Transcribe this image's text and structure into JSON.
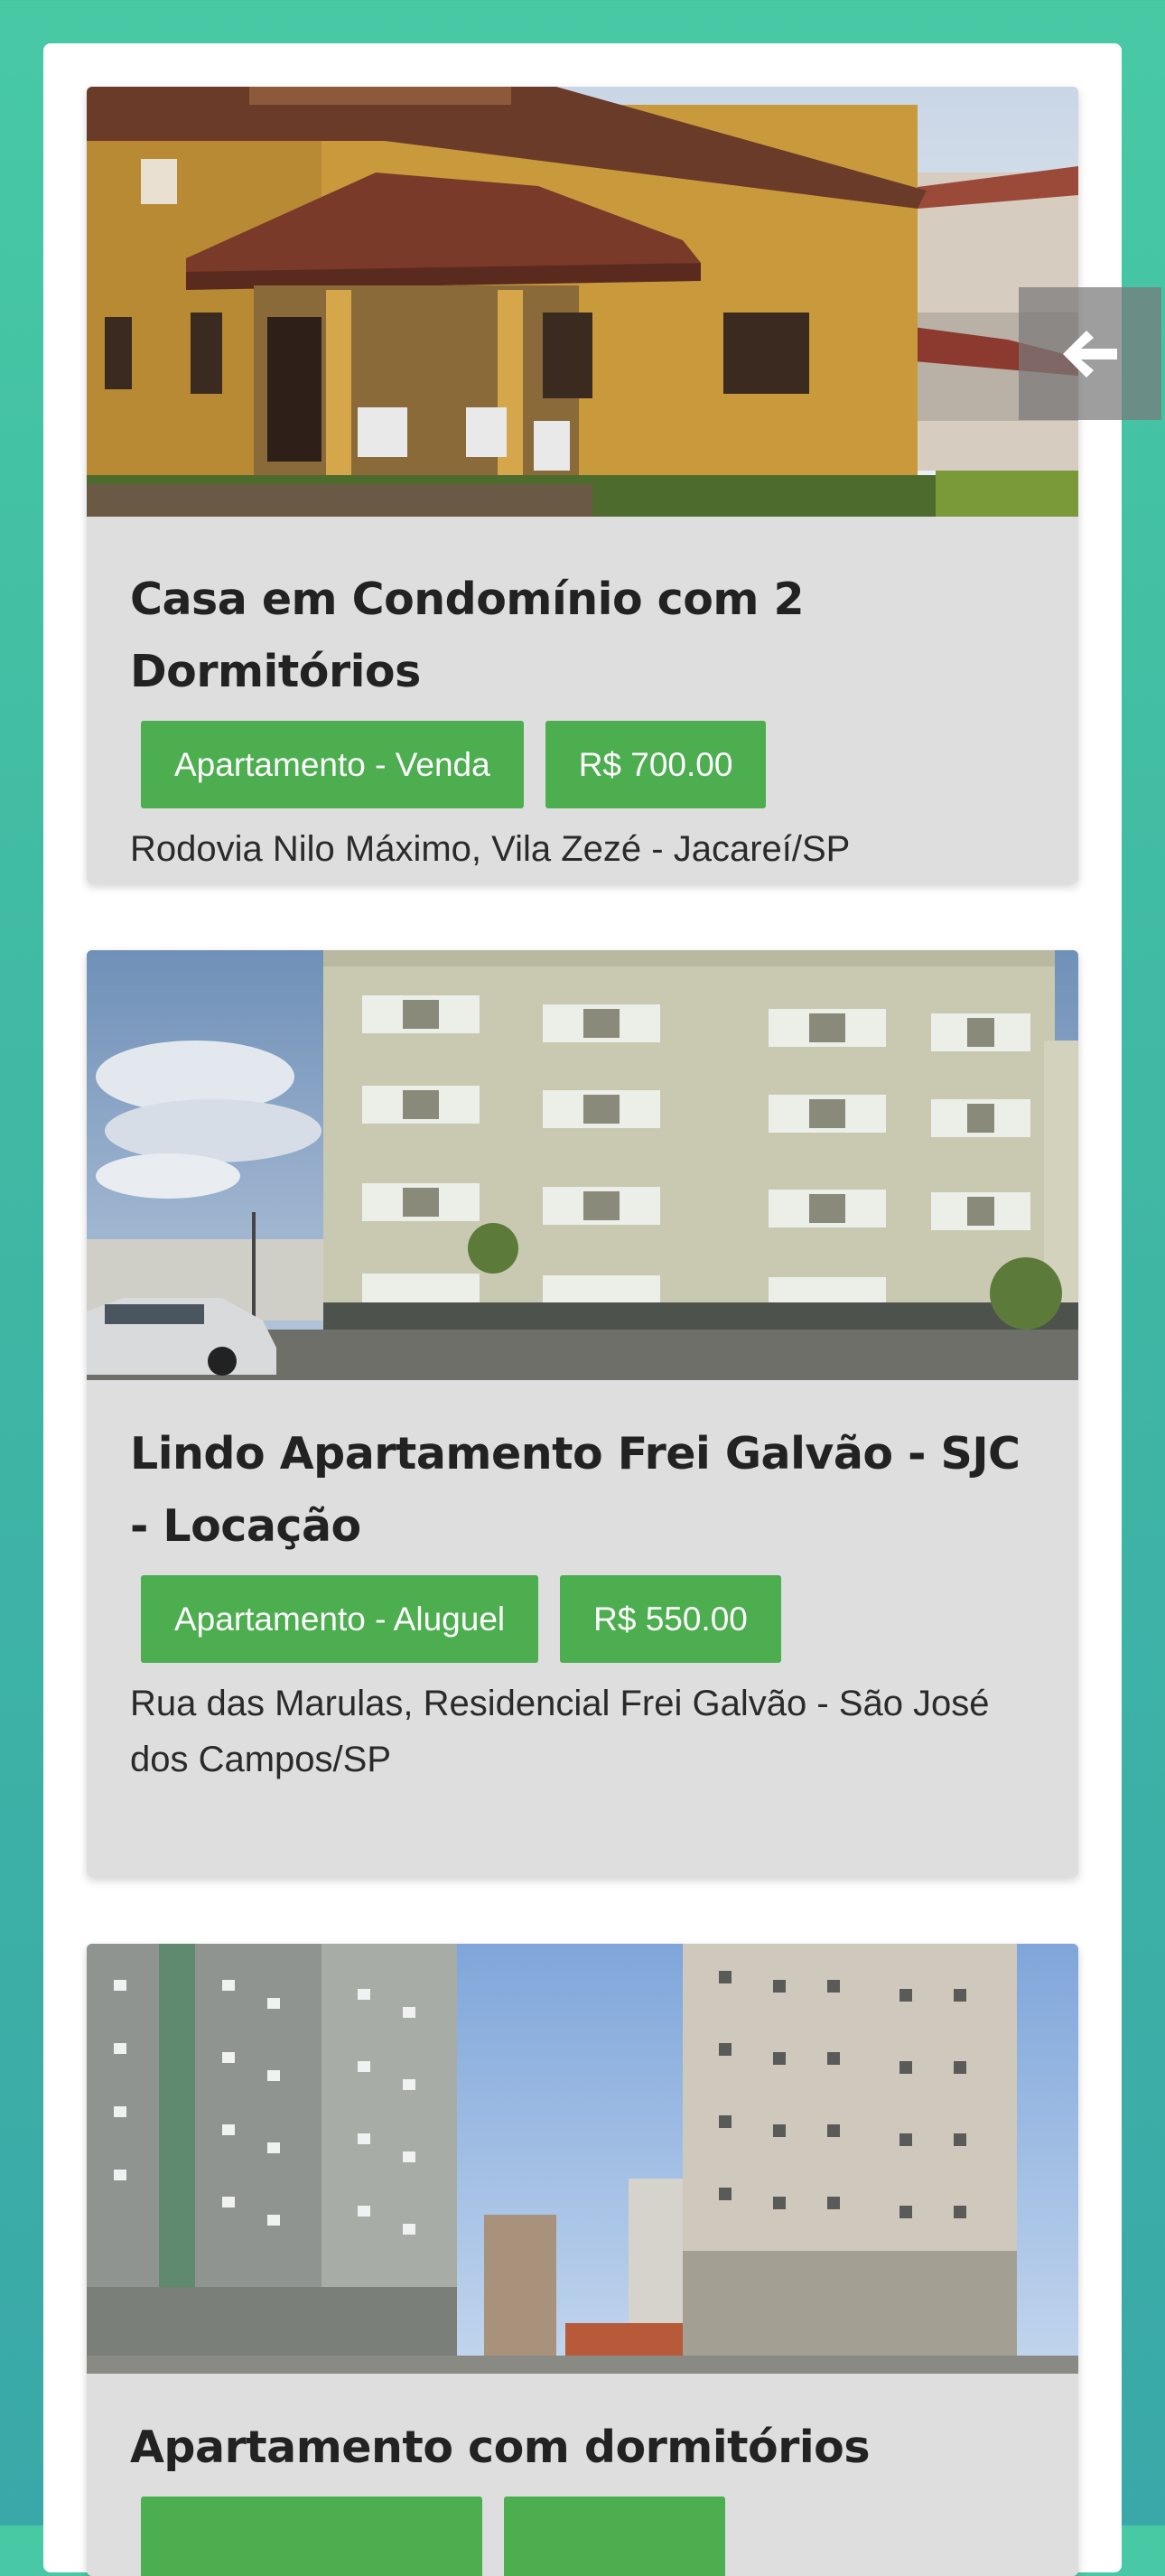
{
  "listings": [
    {
      "title": "Casa em Condomínio com 2 Dormitórios",
      "type_badge": "Apartamento - Venda",
      "price_badge": "R$ 700.00",
      "address": "Rodovia Nilo Máximo, Vila Zezé - Jacareí/SP"
    },
    {
      "title": "Lindo Apartamento Frei Galvão - SJC - Locação",
      "type_badge": "Apartamento - Aluguel",
      "price_badge": "R$ 550.00",
      "address": "Rua das Marulas, Residencial Frei Galvão - São José dos Campos/SP"
    },
    {
      "title": "Apartamento com dormitórios",
      "type_badge": "",
      "price_badge": "",
      "address": ""
    }
  ],
  "icons": {
    "back": "arrow-left-icon"
  },
  "colors": {
    "background": "#48c9a4",
    "card": "#dedede",
    "badge": "#4cae4f",
    "badge_text": "#ffffff"
  }
}
